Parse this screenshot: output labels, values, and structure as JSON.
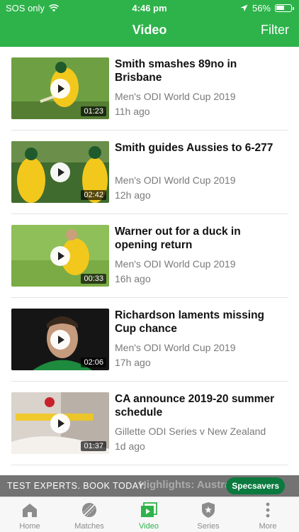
{
  "status_bar": {
    "carrier": "SOS only",
    "time": "4:46 pm",
    "battery": "56%",
    "battery_level": 0.56
  },
  "header": {
    "title": "Video",
    "filter_label": "Filter"
  },
  "videos": [
    {
      "title": "Smith smashes 89no in Brisbane",
      "series": "Men's ODI World Cup 2019",
      "time_ago": "11h ago",
      "duration": "01:23"
    },
    {
      "title": "Smith guides Aussies to 6-277",
      "series": "Men's ODI World Cup 2019",
      "time_ago": "12h ago",
      "duration": "02:42"
    },
    {
      "title": "Warner out for a duck in opening return",
      "series": "Men's ODI World Cup 2019",
      "time_ago": "16h ago",
      "duration": "00:33"
    },
    {
      "title": "Richardson laments missing Cup chance",
      "series": "Men's ODI World Cup 2019",
      "time_ago": "17h ago",
      "duration": "02:06"
    },
    {
      "title": "CA announce 2019-20 summer schedule",
      "series": "Gillette ODI Series v New Zealand",
      "time_ago": "1d ago",
      "duration": "01:37"
    }
  ],
  "ad": {
    "text": "TEST EXPERTS. BOOK TODAY.",
    "brand": "Specsavers",
    "peek_text": "Highlights: Australia e"
  },
  "tabs": [
    {
      "label": "Home",
      "icon": "home-icon"
    },
    {
      "label": "Matches",
      "icon": "ball-icon"
    },
    {
      "label": "Video",
      "icon": "video-icon"
    },
    {
      "label": "Series",
      "icon": "shield-icon"
    },
    {
      "label": "More",
      "icon": "more-dots-icon"
    }
  ],
  "colors": {
    "brand_green": "#2db34a",
    "ad_green": "#0a7a3e"
  }
}
